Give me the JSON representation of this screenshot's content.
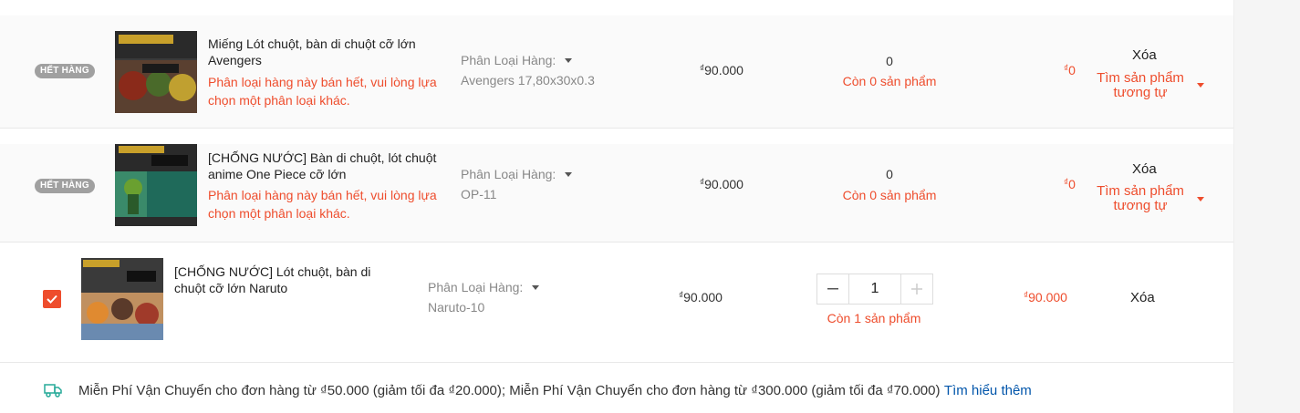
{
  "items": [
    {
      "badge": "HẾT HÀNG",
      "name": "Miếng Lót chuột, bàn di chuột cỡ lớn Avengers",
      "warning": "Phân loại hàng này bán hết, vui lòng lựa chọn một phân loại khác.",
      "variant_label": "Phân Loại Hàng:",
      "variant_value": "Avengers 17,80x30x0.3",
      "currency": "₫",
      "price": "90.000",
      "quantity": "0",
      "stock": "Còn 0 sản phẩm",
      "total": "0",
      "delete": "Xóa",
      "similar": "Tìm sản phẩm tương tự"
    },
    {
      "badge": "HẾT HÀNG",
      "name": "[CHỐNG NƯỚC] Bàn di chuột, lót chuột anime One Piece cỡ lớn",
      "warning": "Phân loại hàng này bán hết, vui lòng lựa chọn một phân loại khác.",
      "variant_label": "Phân Loại Hàng:",
      "variant_value": "OP-11",
      "currency": "₫",
      "price": "90.000",
      "quantity": "0",
      "stock": "Còn 0 sản phẩm",
      "total": "0",
      "delete": "Xóa",
      "similar": "Tìm sản phẩm tương tự"
    },
    {
      "name": "[CHỐNG NƯỚC] Lót chuột, bàn di chuột cỡ lớn Naruto",
      "variant_label": "Phân Loại Hàng:",
      "variant_value": "Naruto-10",
      "currency": "₫",
      "price": "90.000",
      "quantity": "1",
      "stock": "Còn 1 sản phẩm",
      "total": "90.000",
      "delete": "Xóa",
      "checked": true
    }
  ],
  "shipping": {
    "icon": "truck-icon",
    "text": "Miễn Phí Vận Chuyển cho đơn hàng từ ₫50.000 (giảm tối đa ₫20.000); Miễn Phí Vận Chuyển cho đơn hàng từ ₫300.000 (giảm tối đa ₫70.000)",
    "link": "Tìm hiểu thêm"
  },
  "colors": {
    "accent": "#ee4d2d",
    "link": "#0055aa",
    "ship_icon": "#26aa99"
  }
}
